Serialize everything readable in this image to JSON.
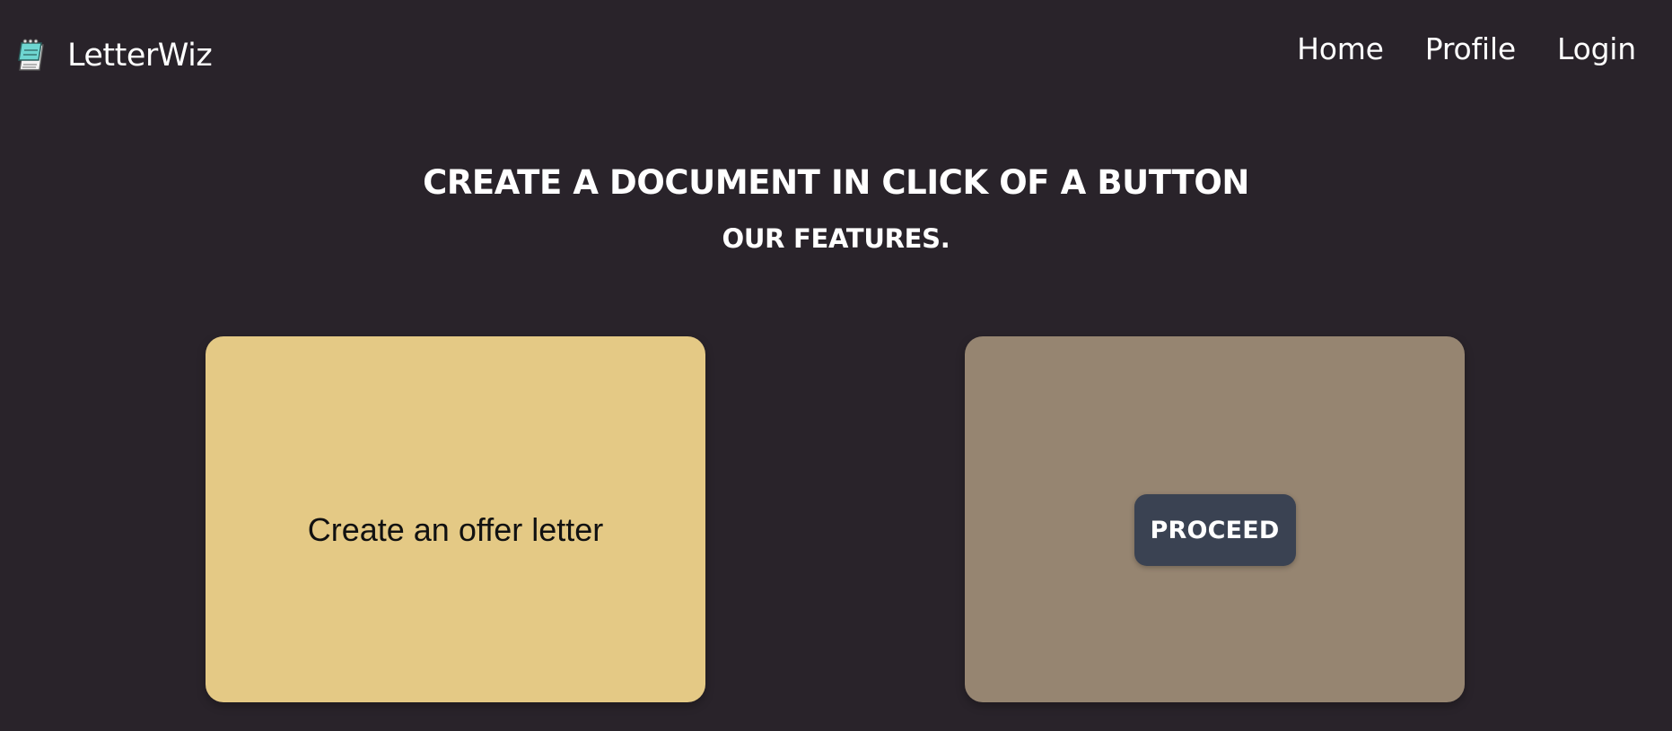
{
  "header": {
    "brand": {
      "icon": "notepad-icon",
      "text": "LetterWiz"
    },
    "nav": {
      "items": [
        {
          "label": "Home"
        },
        {
          "label": "Profile"
        },
        {
          "label": "Login"
        }
      ]
    }
  },
  "main": {
    "title": "CREATE A DOCUMENT IN CLICK OF A BUTTON",
    "subtitle": "OUR FEATURES.",
    "cards": [
      {
        "text": "Create an offer letter",
        "background": "#e4c985"
      },
      {
        "button_label": "PROCEED",
        "background": "#968571",
        "button_color": "#3a4252"
      }
    ]
  },
  "colors": {
    "page_background": "#29232a",
    "text": "#ffffff"
  }
}
